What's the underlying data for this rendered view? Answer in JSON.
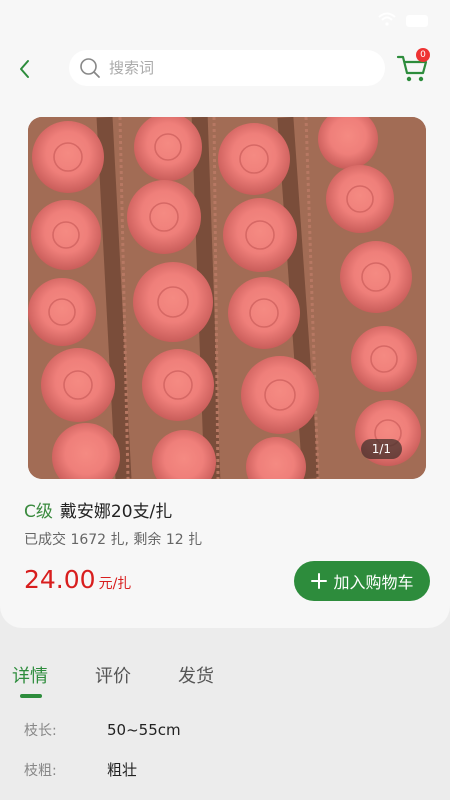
{
  "search": {
    "placeholder": "搜索词"
  },
  "cart": {
    "count": "0"
  },
  "gallery": {
    "counter": "1/1"
  },
  "product": {
    "grade": "C级",
    "name": "戴安娜20支/扎",
    "sales": "已成交 1672 扎, 剩余 12 扎",
    "price": "24.00",
    "price_unit": "元/扎"
  },
  "actions": {
    "add_to_cart": "加入购物车"
  },
  "tabs": [
    {
      "label": "详情"
    },
    {
      "label": "评价"
    },
    {
      "label": "发货"
    }
  ],
  "details": [
    {
      "label": "枝长:",
      "value": "50~55cm"
    },
    {
      "label": "枝粗:",
      "value": "粗壮"
    }
  ],
  "colors": {
    "accent": "#2d8c3c",
    "price": "#d81e1e",
    "badge": "#e33333"
  }
}
